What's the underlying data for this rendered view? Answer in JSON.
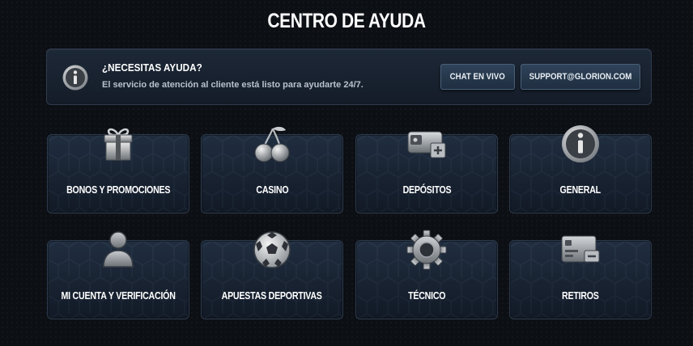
{
  "page": {
    "title": "CENTRO DE AYUDA"
  },
  "help": {
    "heading": "¿NECESITAS AYUDA?",
    "text": "El servicio de atención al cliente está listo para ayudarte 24/7.",
    "chat_label": "CHAT EN VIVO",
    "email_label": "SUPPORT@GLORION.COM"
  },
  "categories": [
    {
      "label": "BONOS Y PROMOCIONES",
      "icon": "gift-icon"
    },
    {
      "label": "CASINO",
      "icon": "cherry-icon"
    },
    {
      "label": "DEPÓSITOS",
      "icon": "wallet-icon"
    },
    {
      "label": "GENERAL",
      "icon": "info-icon"
    },
    {
      "label": "MI CUENTA Y VERIFICACIÓN",
      "icon": "user-icon"
    },
    {
      "label": "APUESTAS DEPORTIVAS",
      "icon": "soccer-ball-icon"
    },
    {
      "label": "TÉCNICO",
      "icon": "gear-icon"
    },
    {
      "label": "RETIROS",
      "icon": "withdraw-card-icon"
    }
  ]
}
